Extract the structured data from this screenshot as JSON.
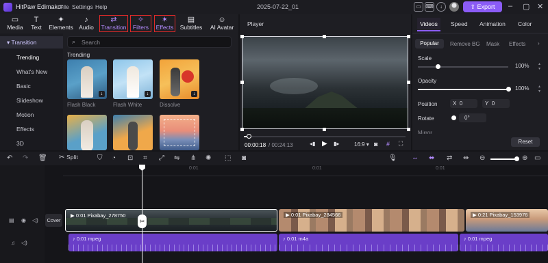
{
  "app": {
    "name": "HitPaw Edimakor",
    "project": "2025-07-22_01"
  },
  "menu": [
    "File",
    "Settings",
    "Help"
  ],
  "titlebar": {
    "export_label": "Export",
    "icons": [
      "message-icon",
      "keyboard-icon",
      "download-icon",
      "account-avatar",
      "minimize-icon",
      "maximize-icon",
      "close-icon"
    ]
  },
  "toolbar": {
    "items": [
      {
        "label": "Media",
        "icon": "▭"
      },
      {
        "label": "Text",
        "icon": "T"
      },
      {
        "label": "Elements",
        "icon": "✦"
      },
      {
        "label": "Audio",
        "icon": "♪"
      },
      {
        "label": "Transition",
        "icon": "⇄"
      },
      {
        "label": "Filters",
        "icon": "✧"
      },
      {
        "label": "Effects",
        "icon": "✶"
      },
      {
        "label": "Subtitles",
        "icon": "▤"
      },
      {
        "label": "AI Avatar",
        "icon": "☺"
      }
    ]
  },
  "sidenav": {
    "header": "Transition",
    "items": [
      "Trending",
      "What's New",
      "Basic",
      "Slideshow",
      "Motion",
      "Effects",
      "3D"
    ]
  },
  "search": {
    "placeholder": "Search"
  },
  "content": {
    "section": "Trending",
    "items": [
      "Flash Black",
      "Flash White",
      "Dissolve"
    ]
  },
  "player": {
    "title": "Player",
    "time_current": "00:00:18",
    "time_total": "/ 00:24:13",
    "aspect": "16:9",
    "progress": 0.03
  },
  "props": {
    "tabs": [
      "Videos",
      "Speed",
      "Animation",
      "Color"
    ],
    "subtabs": [
      "Popular",
      "Remove BG",
      "Mask",
      "Effects"
    ],
    "scale_label": "Scale",
    "scale_value": "100%",
    "scale_level": 0.22,
    "opacity_label": "Opacity",
    "opacity_value": "100%",
    "opacity_level": 1.0,
    "position_label": "Position",
    "x_label": "X",
    "x_value": "0",
    "y_label": "Y",
    "y_value": "0",
    "rotate_label": "Rotate",
    "rotate_value": "0°",
    "mirror_label": "Mirror",
    "reset_label": "Reset"
  },
  "timeline": {
    "split_label": "Split",
    "ruler": [
      "0:01",
      "0:01",
      "0:01"
    ],
    "cover_label": "Cover",
    "clips": [
      "0:01 Pixabay_278750",
      "0:01 Pixabay_284566",
      "0:21 Pixabay_153976"
    ],
    "audio": [
      "0:01 mpeg",
      "0:01 m4a",
      "0:01 mpeg"
    ]
  }
}
